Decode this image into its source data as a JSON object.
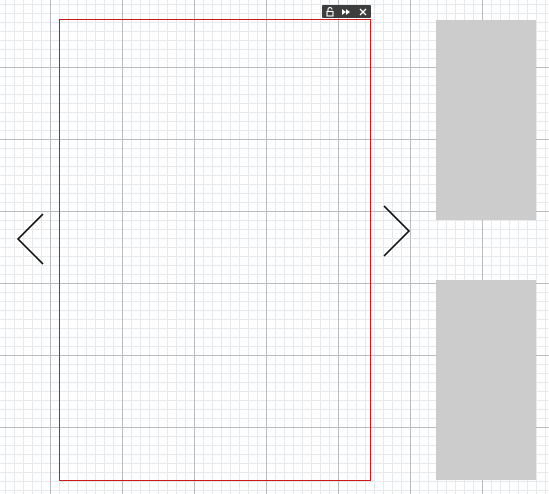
{
  "canvas": {
    "grid_major_color": "#b9bec3",
    "grid_minor_color": "#e7eaec",
    "background": "#ffffff"
  },
  "page_frame": {
    "border_color": "#cc1a1a",
    "toolbar": {
      "buttons": [
        {
          "name": "lock-button",
          "icon": "lock-icon"
        },
        {
          "name": "fast-forward-button",
          "icon": "fast-forward-icon"
        },
        {
          "name": "close-button",
          "icon": "close-icon"
        }
      ]
    }
  },
  "navigation": {
    "prev_icon": "chevron-left-icon",
    "next_icon": "chevron-right-icon"
  },
  "thumbnails": {
    "color": "#cccccc",
    "items": [
      "thumbnail-1",
      "thumbnail-2"
    ]
  }
}
